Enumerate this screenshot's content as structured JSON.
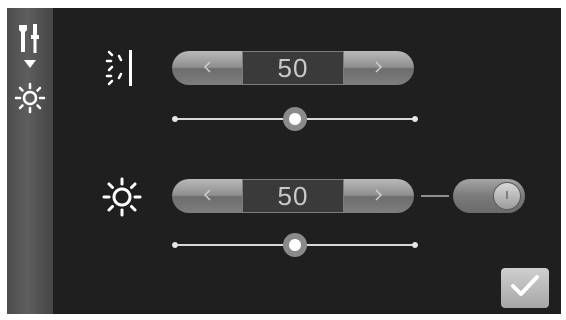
{
  "sidebar": {
    "icons": [
      "tools-icon",
      "dropdown-arrow-icon",
      "brightness-icon"
    ]
  },
  "rows": [
    {
      "icon": "contrast-edge-icon",
      "value": "50",
      "slider_percent": 50
    },
    {
      "icon": "brightness-icon",
      "value": "50",
      "slider_percent": 50,
      "toggle": "on"
    }
  ],
  "confirm": {
    "icon": "checkmark-icon"
  },
  "colors": {
    "background": "#201f1f",
    "sidebar": "#555555",
    "button": "#9a9a9a",
    "value_text": "#c9c9c9",
    "track": "#d8d8d8"
  }
}
